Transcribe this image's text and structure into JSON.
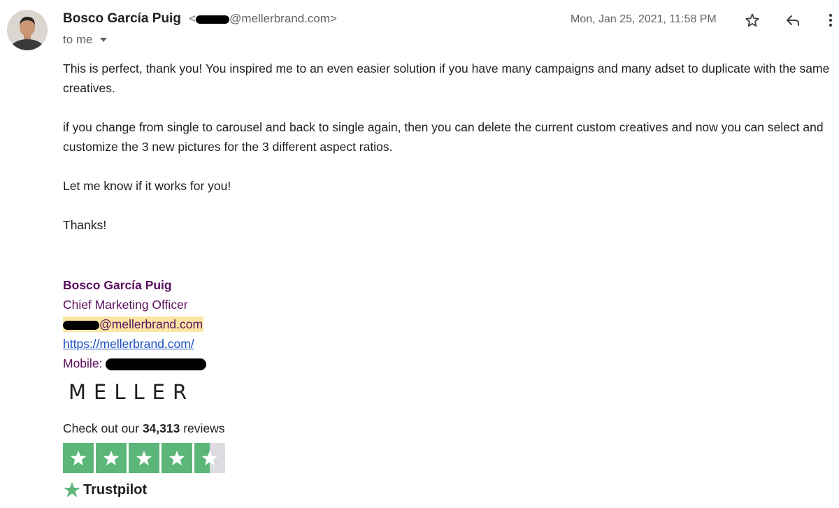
{
  "header": {
    "sender_name": "Bosco García Puig",
    "sender_email_prefix": "<",
    "sender_email_domain": "@mellerbrand.com>",
    "recipient": "to me",
    "date": "Mon, Jan 25, 2021, 11:58 PM"
  },
  "icons": {
    "star": "star-outline-icon",
    "reply": "reply-icon",
    "more": "more-vert-icon",
    "recipient_details": "chevron-down-icon"
  },
  "body": {
    "paragraphs": [
      "This is perfect, thank you! You inspired me to an even easier solution if you have many campaigns and many adset to duplicate with the same creatives.",
      "if you change from single to carousel and back to single again, then you can delete the current custom creatives and now you can select and customize the 3 new pictures for the 3 different aspect ratios.",
      "Let me know if it works for you!",
      "Thanks!"
    ]
  },
  "signature": {
    "name": "Bosco García Puig",
    "title": "Chief Marketing Officer",
    "email_domain": "@mellerbrand.com",
    "website": "https://mellerbrand.com/",
    "mobile_label": "Mobile: ",
    "logo_text": "MELLER",
    "reviews_prefix": "Check out our ",
    "reviews_count": "34,313",
    "reviews_suffix": " reviews",
    "rating_stars": 4.5,
    "trustpilot_label": "Trustpilot"
  },
  "colors": {
    "signature_text": "#5b0f5e",
    "link": "#1a4fc9",
    "email_highlight": "#fbe6a4",
    "trustpilot_green": "#5cb67a"
  }
}
